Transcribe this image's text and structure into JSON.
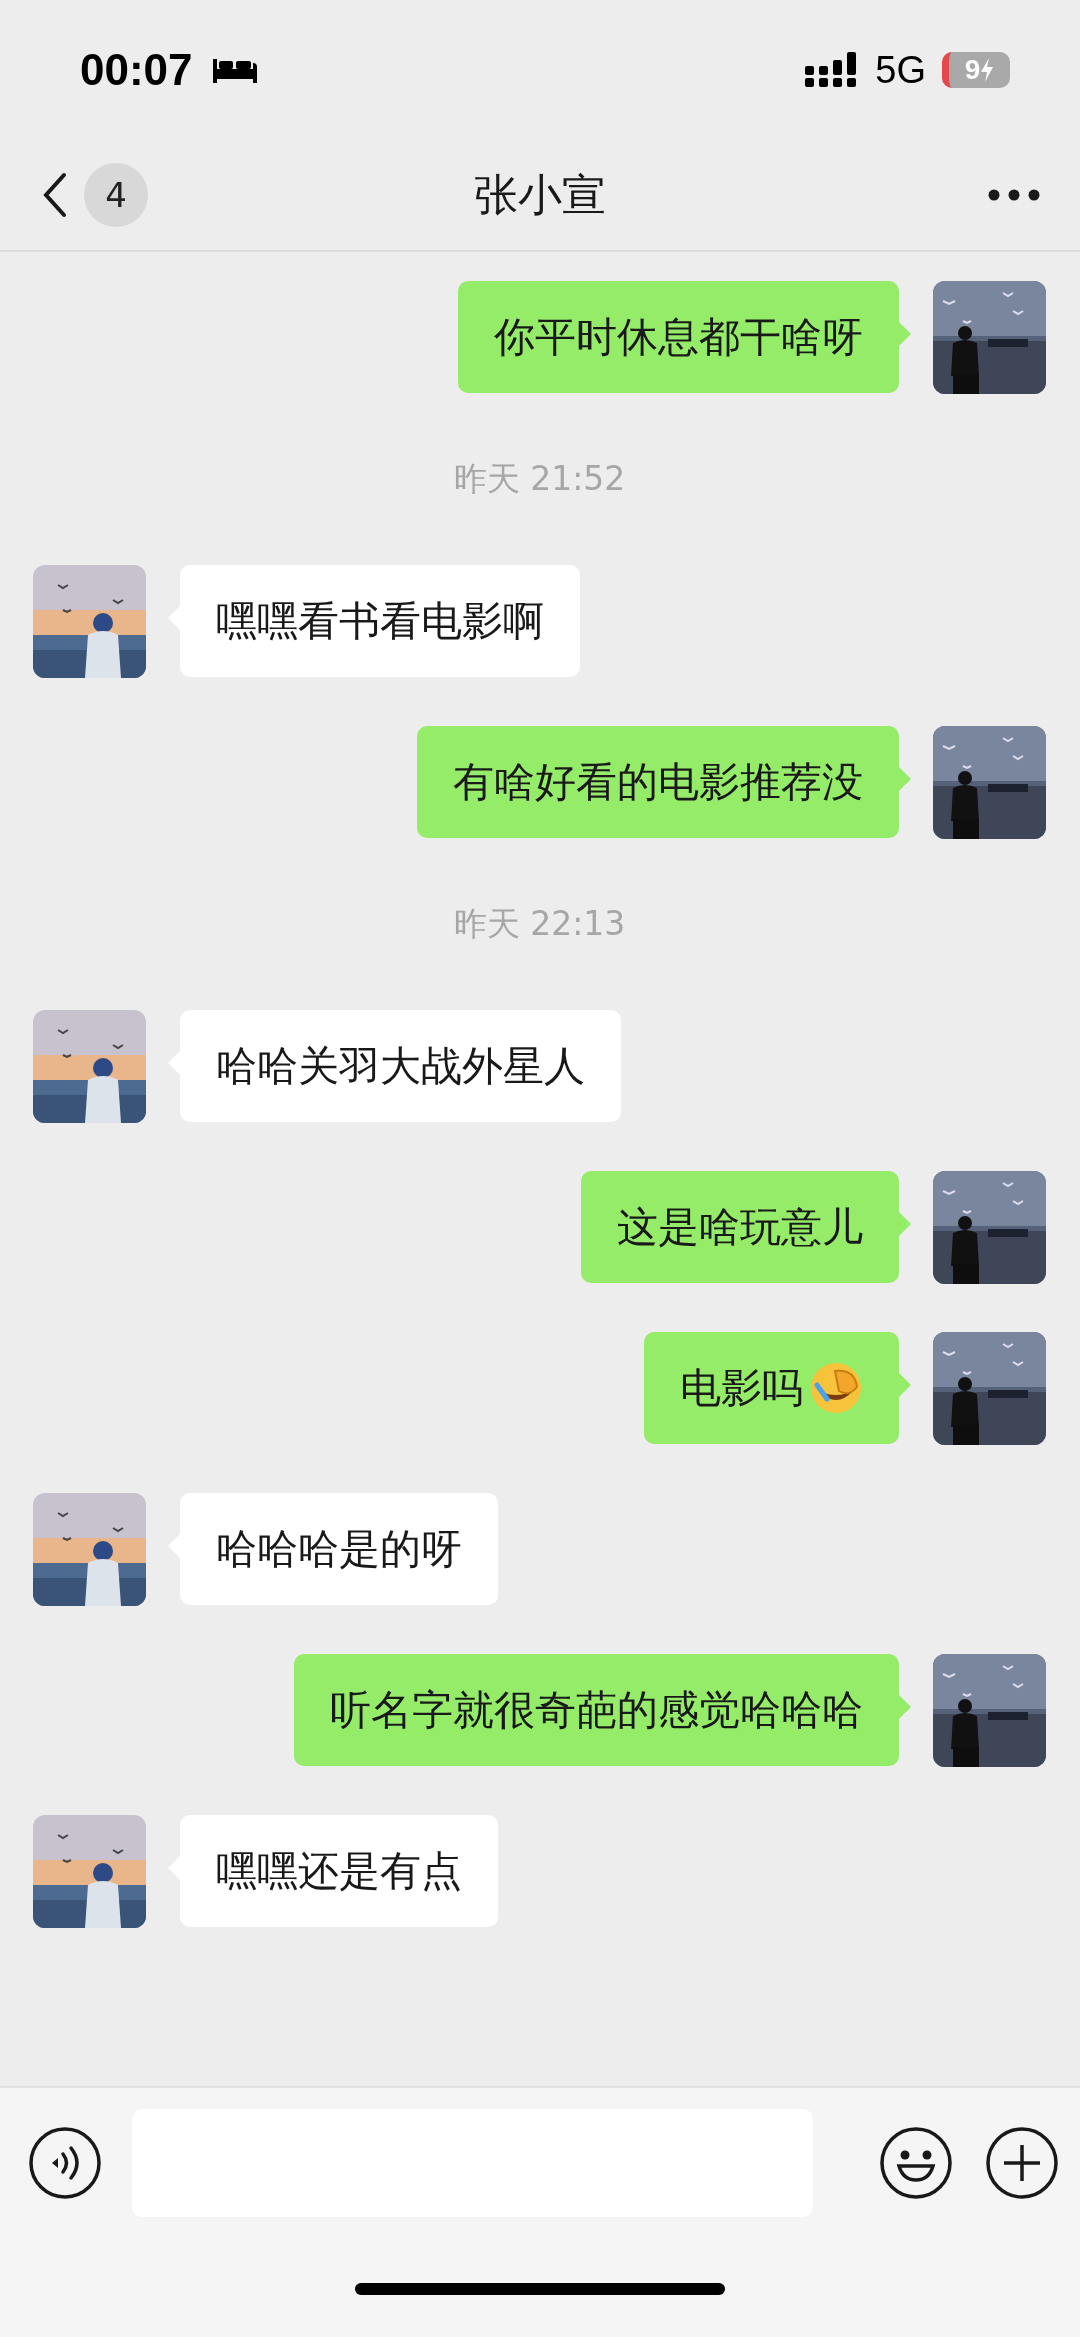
{
  "status_bar": {
    "time": "00:07",
    "network": "5G",
    "battery": "9"
  },
  "header": {
    "back_count": "4",
    "title": "张小宣"
  },
  "messages": [
    {
      "kind": "sent",
      "text": "你平时休息都干啥呀"
    },
    {
      "kind": "time",
      "text": "昨天 21:52"
    },
    {
      "kind": "received",
      "text": "嘿嘿看书看电影啊"
    },
    {
      "kind": "sent",
      "text": "有啥好看的电影推荐没"
    },
    {
      "kind": "time",
      "text": "昨天 22:13"
    },
    {
      "kind": "received",
      "text": "哈哈关羽大战外星人"
    },
    {
      "kind": "sent",
      "text": "这是啥玩意儿"
    },
    {
      "kind": "sent",
      "text": "电影吗",
      "emoji": true
    },
    {
      "kind": "received",
      "text": "哈哈哈是的呀"
    },
    {
      "kind": "sent",
      "text": "听名字就很奇葩的感觉哈哈哈"
    },
    {
      "kind": "received",
      "text": "嘿嘿还是有点"
    }
  ]
}
